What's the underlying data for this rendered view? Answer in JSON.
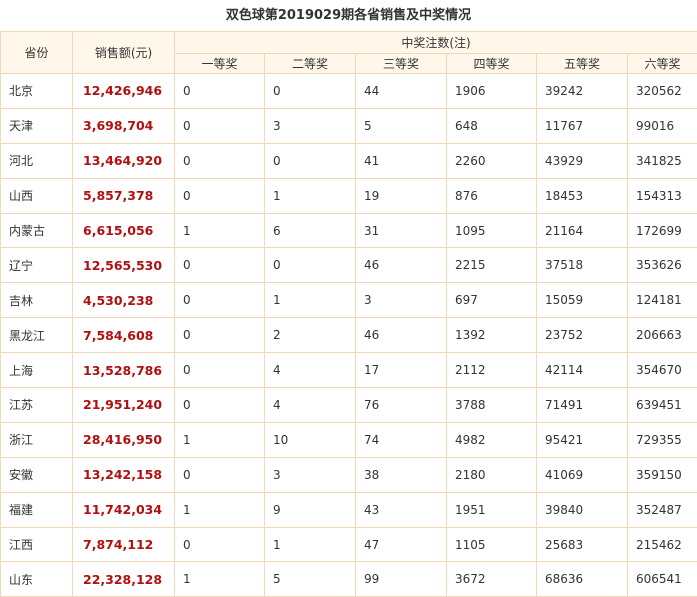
{
  "title": "双色球第2019029期各省销售及中奖情况",
  "headers": {
    "province": "省份",
    "sales": "销售额(元)",
    "winners": "中奖注数(注)",
    "tiers": [
      "一等奖",
      "二等奖",
      "三等奖",
      "四等奖",
      "五等奖",
      "六等奖"
    ]
  },
  "rows": [
    {
      "province": "北京",
      "sales": "12,426,946",
      "tiers": [
        "0",
        "0",
        "44",
        "1906",
        "39242",
        "320562"
      ]
    },
    {
      "province": "天津",
      "sales": "3,698,704",
      "tiers": [
        "0",
        "3",
        "5",
        "648",
        "11767",
        "99016"
      ]
    },
    {
      "province": "河北",
      "sales": "13,464,920",
      "tiers": [
        "0",
        "0",
        "41",
        "2260",
        "43929",
        "341825"
      ]
    },
    {
      "province": "山西",
      "sales": "5,857,378",
      "tiers": [
        "0",
        "1",
        "19",
        "876",
        "18453",
        "154313"
      ]
    },
    {
      "province": "内蒙古",
      "sales": "6,615,056",
      "tiers": [
        "1",
        "6",
        "31",
        "1095",
        "21164",
        "172699"
      ]
    },
    {
      "province": "辽宁",
      "sales": "12,565,530",
      "tiers": [
        "0",
        "0",
        "46",
        "2215",
        "37518",
        "353626"
      ]
    },
    {
      "province": "吉林",
      "sales": "4,530,238",
      "tiers": [
        "0",
        "1",
        "3",
        "697",
        "15059",
        "124181"
      ]
    },
    {
      "province": "黑龙江",
      "sales": "7,584,608",
      "tiers": [
        "0",
        "2",
        "46",
        "1392",
        "23752",
        "206663"
      ]
    },
    {
      "province": "上海",
      "sales": "13,528,786",
      "tiers": [
        "0",
        "4",
        "17",
        "2112",
        "42114",
        "354670"
      ]
    },
    {
      "province": "江苏",
      "sales": "21,951,240",
      "tiers": [
        "0",
        "4",
        "76",
        "3788",
        "71491",
        "639451"
      ]
    },
    {
      "province": "浙江",
      "sales": "28,416,950",
      "tiers": [
        "1",
        "10",
        "74",
        "4982",
        "95421",
        "729355"
      ]
    },
    {
      "province": "安徽",
      "sales": "13,242,158",
      "tiers": [
        "0",
        "3",
        "38",
        "2180",
        "41069",
        "359150"
      ]
    },
    {
      "province": "福建",
      "sales": "11,742,034",
      "tiers": [
        "1",
        "9",
        "43",
        "1951",
        "39840",
        "352487"
      ]
    },
    {
      "province": "江西",
      "sales": "7,874,112",
      "tiers": [
        "0",
        "1",
        "47",
        "1105",
        "25683",
        "215462"
      ]
    },
    {
      "province": "山东",
      "sales": "22,328,128",
      "tiers": [
        "1",
        "5",
        "99",
        "3672",
        "68636",
        "606541"
      ]
    }
  ]
}
